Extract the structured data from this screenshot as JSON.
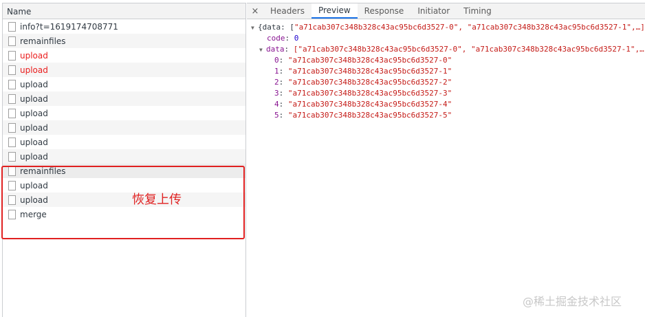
{
  "left": {
    "header": "Name",
    "rows": [
      {
        "label": "info?t=1619174708771",
        "status": "normal"
      },
      {
        "label": "remainfiles",
        "status": "normal"
      },
      {
        "label": "upload",
        "status": "error"
      },
      {
        "label": "upload",
        "status": "error"
      },
      {
        "label": "upload",
        "status": "normal"
      },
      {
        "label": "upload",
        "status": "normal"
      },
      {
        "label": "upload",
        "status": "normal"
      },
      {
        "label": "upload",
        "status": "normal"
      },
      {
        "label": "upload",
        "status": "normal"
      },
      {
        "label": "upload",
        "status": "normal"
      },
      {
        "label": "remainfiles",
        "status": "normal"
      },
      {
        "label": "upload",
        "status": "normal"
      },
      {
        "label": "upload",
        "status": "normal"
      },
      {
        "label": "merge",
        "status": "normal"
      }
    ]
  },
  "annotation": {
    "text": "恢复上传",
    "color": "#e02020"
  },
  "right": {
    "close_icon": "×",
    "tabs": [
      "Headers",
      "Preview",
      "Response",
      "Initiator",
      "Timing"
    ],
    "active_tab": "Preview",
    "preview": {
      "summary_prefix": "{data: [",
      "summary_items": "\"a71cab307c348b328c43ac95bc6d3527-0\", \"a71cab307c348b328c43ac95bc6d3527-1\",…]",
      "code_key": "code",
      "code_value": "0",
      "data_key": "data",
      "data_summary": "[\"a71cab307c348b328c43ac95bc6d3527-0\", \"a71cab307c348b328c43ac95bc6d3527-1\",…]",
      "items": [
        {
          "index": "0",
          "value": "\"a71cab307c348b328c43ac95bc6d3527-0\""
        },
        {
          "index": "1",
          "value": "\"a71cab307c348b328c43ac95bc6d3527-1\""
        },
        {
          "index": "2",
          "value": "\"a71cab307c348b328c43ac95bc6d3527-2\""
        },
        {
          "index": "3",
          "value": "\"a71cab307c348b328c43ac95bc6d3527-3\""
        },
        {
          "index": "4",
          "value": "\"a71cab307c348b328c43ac95bc6d3527-4\""
        },
        {
          "index": "5",
          "value": "\"a71cab307c348b328c43ac95bc6d3527-5\""
        }
      ]
    }
  },
  "watermark": "@稀土掘金技术社区",
  "colors": {
    "error_text": "#ea1c1c",
    "active_tab_underline": "#1a73e8",
    "json_key": "#881391",
    "json_string": "#c41a16",
    "json_number": "#1c00cf"
  }
}
